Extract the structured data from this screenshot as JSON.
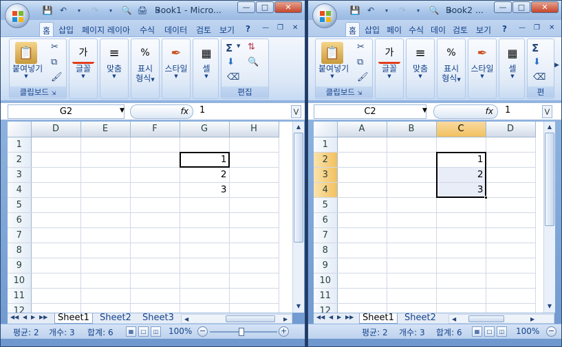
{
  "windows": [
    {
      "title": "Book1 - Micro...",
      "tabs": [
        "홈",
        "삽입",
        "페이지 레이아",
        "수식",
        "데이터",
        "검토",
        "보기"
      ],
      "groups": {
        "clipboard": "클립보드",
        "edit": "편집"
      },
      "buttons": {
        "paste": "붙여넣기",
        "font": "글꼴",
        "align": "맞춤",
        "number_a": "표시",
        "number_b": "형식",
        "style": "스타일",
        "cells": "셀"
      },
      "namebox": "G2",
      "fx": "fx",
      "formula": "1",
      "columns": [
        "D",
        "E",
        "F",
        "G",
        "H"
      ],
      "rows": [
        "1",
        "2",
        "3",
        "4",
        "5",
        "6",
        "7",
        "8",
        "9",
        "10",
        "11",
        "12"
      ],
      "cells": {
        "r2": [
          "",
          "",
          "",
          "1",
          ""
        ],
        "r3": [
          "",
          "",
          "",
          "2",
          ""
        ],
        "r4": [
          "",
          "",
          "",
          "3",
          ""
        ]
      },
      "sheets": [
        "Sheet1",
        "Sheet2",
        "Sheet3"
      ],
      "status": {
        "avg": "평균: 2",
        "count": "개수: 3",
        "sum": "합계: 6",
        "zoom": "100%"
      }
    },
    {
      "title": "Book2 ...",
      "tabs": [
        "홈",
        "삽입",
        "페이",
        "수식",
        "데이",
        "검토",
        "보기"
      ],
      "groups": {
        "clipboard": "클립보드",
        "edit": "편"
      },
      "buttons": {
        "paste": "붙여넣기",
        "font": "글꼴",
        "align": "맞춤",
        "number_a": "표시",
        "number_b": "형식",
        "style": "스타일",
        "cells": "셀"
      },
      "namebox": "C2",
      "fx": "fx",
      "formula": "1",
      "columns": [
        "A",
        "B",
        "C",
        "D"
      ],
      "rows": [
        "1",
        "2",
        "3",
        "4",
        "5",
        "6",
        "7",
        "8",
        "9",
        "10",
        "11",
        "12"
      ],
      "cells": {
        "r2": [
          "",
          "",
          "1",
          ""
        ],
        "r3": [
          "",
          "",
          "2",
          ""
        ],
        "r4": [
          "",
          "",
          "3",
          ""
        ]
      },
      "sheets": [
        "Sheet1",
        "Sheet2"
      ],
      "status": {
        "avg": "평균: 2",
        "count": "개수: 3",
        "sum": "합계: 6",
        "zoom": "100%"
      }
    }
  ],
  "icons": {
    "office": "office-logo",
    "save": "save-icon",
    "undo": "undo-icon",
    "redo": "redo-icon",
    "preview": "print-preview-icon",
    "print": "print-icon",
    "help": "help-icon"
  },
  "colors": {
    "accent": "#15428b",
    "selection": "#f1c15f",
    "sel_fill": "#e9edf8"
  }
}
